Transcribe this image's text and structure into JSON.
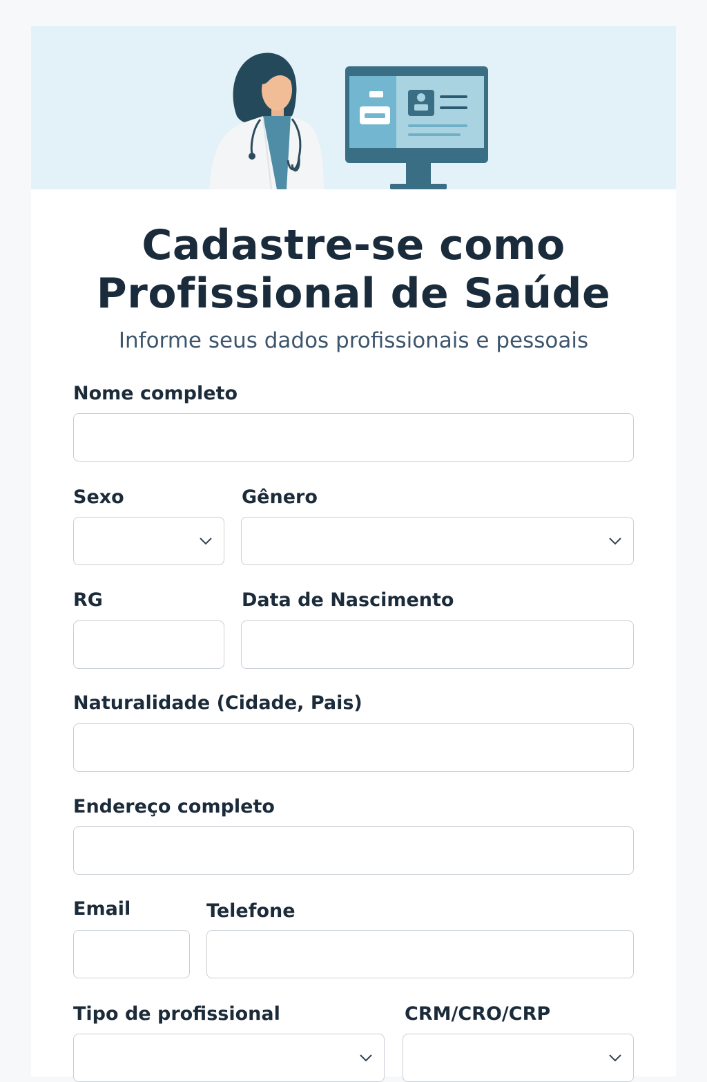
{
  "header": {
    "title_line1": "Cadastre-se como",
    "title_line2": "Profissional de Saúde",
    "subtitle": "Informe seus dados profissionais e pessoais"
  },
  "form": {
    "nome_completo": {
      "label": "Nome completo",
      "value": "",
      "placeholder": ""
    },
    "sexo": {
      "label": "Sexo",
      "value": ""
    },
    "genero": {
      "label": "Gênero",
      "value": ""
    },
    "rg": {
      "label": "RG",
      "value": ""
    },
    "data_nascimento": {
      "label": "Data de Nascimento",
      "value": ""
    },
    "naturalidade": {
      "label": "Naturalidade (Cidade, Pais)",
      "value": ""
    },
    "endereco": {
      "label": "Endereço completo",
      "value": ""
    },
    "email": {
      "label": "Email",
      "value": ""
    },
    "telefone": {
      "label": "Telefone",
      "value": ""
    },
    "tipo_profissional": {
      "label": "Tipo de profissional",
      "value": ""
    },
    "registro": {
      "label": "CRM/CRO/CRP",
      "value": ""
    }
  },
  "icons": {
    "banner_doctor": "doctor-illustration",
    "banner_monitor": "computer-monitor-illustration",
    "select_arrow": "chevron-down-icon"
  },
  "colors": {
    "banner_bg": "#e2f2f8",
    "primary_text": "#1a2b3b",
    "subtitle_text": "#3d566d",
    "field_border": "#c9cfd5",
    "illustration_teal": "#3a6e85"
  }
}
